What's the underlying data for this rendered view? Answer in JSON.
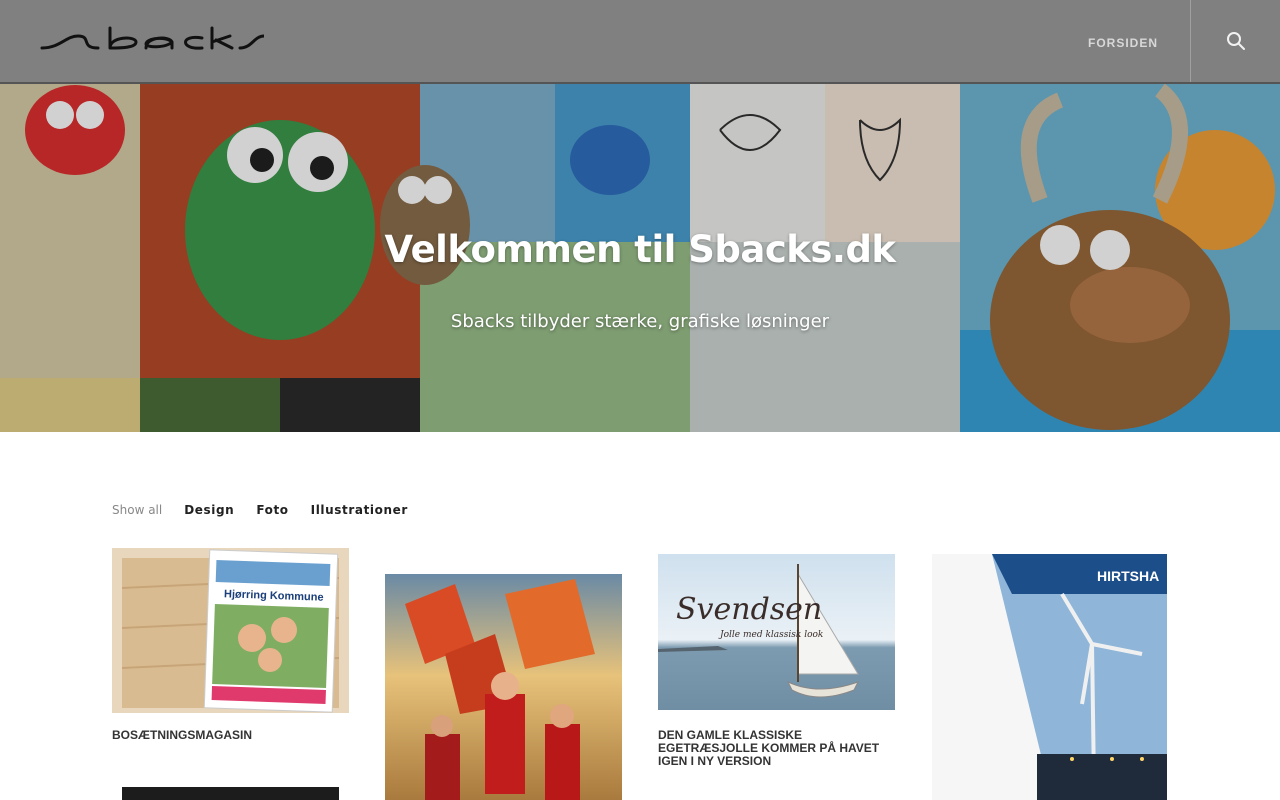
{
  "header": {
    "logo_text": "sbacks",
    "nav": [
      {
        "label": "FORSIDEN"
      }
    ],
    "search_icon": "search-icon"
  },
  "hero": {
    "title": "Velkommen til Sbacks.dk",
    "subtitle": "Sbacks tilbyder stærke, grafiske løsninger"
  },
  "filters": {
    "items": [
      {
        "label": "Show all",
        "active": true
      },
      {
        "label": "Design",
        "active": false
      },
      {
        "label": "Foto",
        "active": false
      },
      {
        "label": "Illustrationer",
        "active": false
      }
    ]
  },
  "portfolio": {
    "items": [
      {
        "title": "BOSÆTNINGSMAGASIN",
        "thumb_text": "Hjørring Kommune"
      },
      {
        "title": ""
      },
      {
        "title": "DEN GAMLE KLASSISKE EGETRÆSJOLLE KOMMER PÅ HAVET IGEN I NY VERSION",
        "thumb_text": "Svendsen",
        "thumb_subtext": "Jolle med klassisk look"
      },
      {
        "title": "",
        "thumb_text": "HIRTSHA"
      }
    ]
  }
}
